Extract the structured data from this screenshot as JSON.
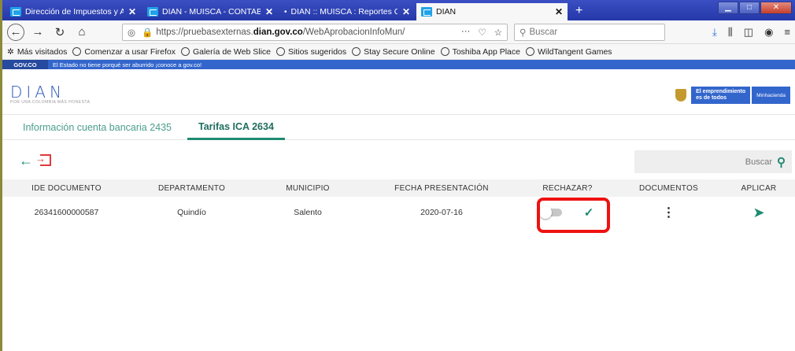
{
  "browser": {
    "tabs": [
      {
        "label": "Dirección de Impuestos y Adua",
        "active": false
      },
      {
        "label": "DIAN - MUISCA - CONTABILID",
        "active": false
      },
      {
        "label": "DIAN :: MUISCA : Reportes Con",
        "active": false
      },
      {
        "label": "DIAN",
        "active": true
      }
    ],
    "close_glyph": "✕",
    "newtab_glyph": "+",
    "url_prefix": "https://pruebasexternas.",
    "url_domain": "dian.gov.co",
    "url_path": "/WebAprobacionInfoMun/",
    "search_placeholder": "Buscar",
    "bookmarks": [
      "Más visitados",
      "Comenzar a usar Firefox",
      "Galería de Web Slice",
      "Sitios sugeridos",
      "Stay Secure Online",
      "Toshiba App Place",
      "WildTangent Games"
    ]
  },
  "govbar": {
    "logo": "GOV.CO",
    "message": "El Estado no tiene porqué ser aburrido ¡conoce a gov.co!"
  },
  "header": {
    "logo": "DIAN",
    "tagline": "POR UNA COLOMBIA MÁS HONESTA",
    "badge_line1": "El emprendimiento",
    "badge_line2": "es de todos",
    "ministry": "Minhacienda"
  },
  "tabs": [
    "Información cuenta bancaria 2435",
    "Tarifas ICA 2634"
  ],
  "active_tab": 1,
  "search": {
    "placeholder": "Buscar"
  },
  "table": {
    "columns": [
      "IDE DOCUMENTO",
      "DEPARTAMENTO",
      "MUNICIPIO",
      "FECHA PRESENTACIÓN",
      "RECHAZAR?",
      "DOCUMENTOS",
      "APLICAR"
    ],
    "rows": [
      {
        "ide": "26341600000587",
        "departamento": "Quindío",
        "municipio": "Salento",
        "fecha": "2020-07-16",
        "rechazar": false
      }
    ]
  },
  "colors": {
    "accent": "#1e8a72",
    "brand": "#3366cc",
    "highlight": "#ee1111"
  }
}
